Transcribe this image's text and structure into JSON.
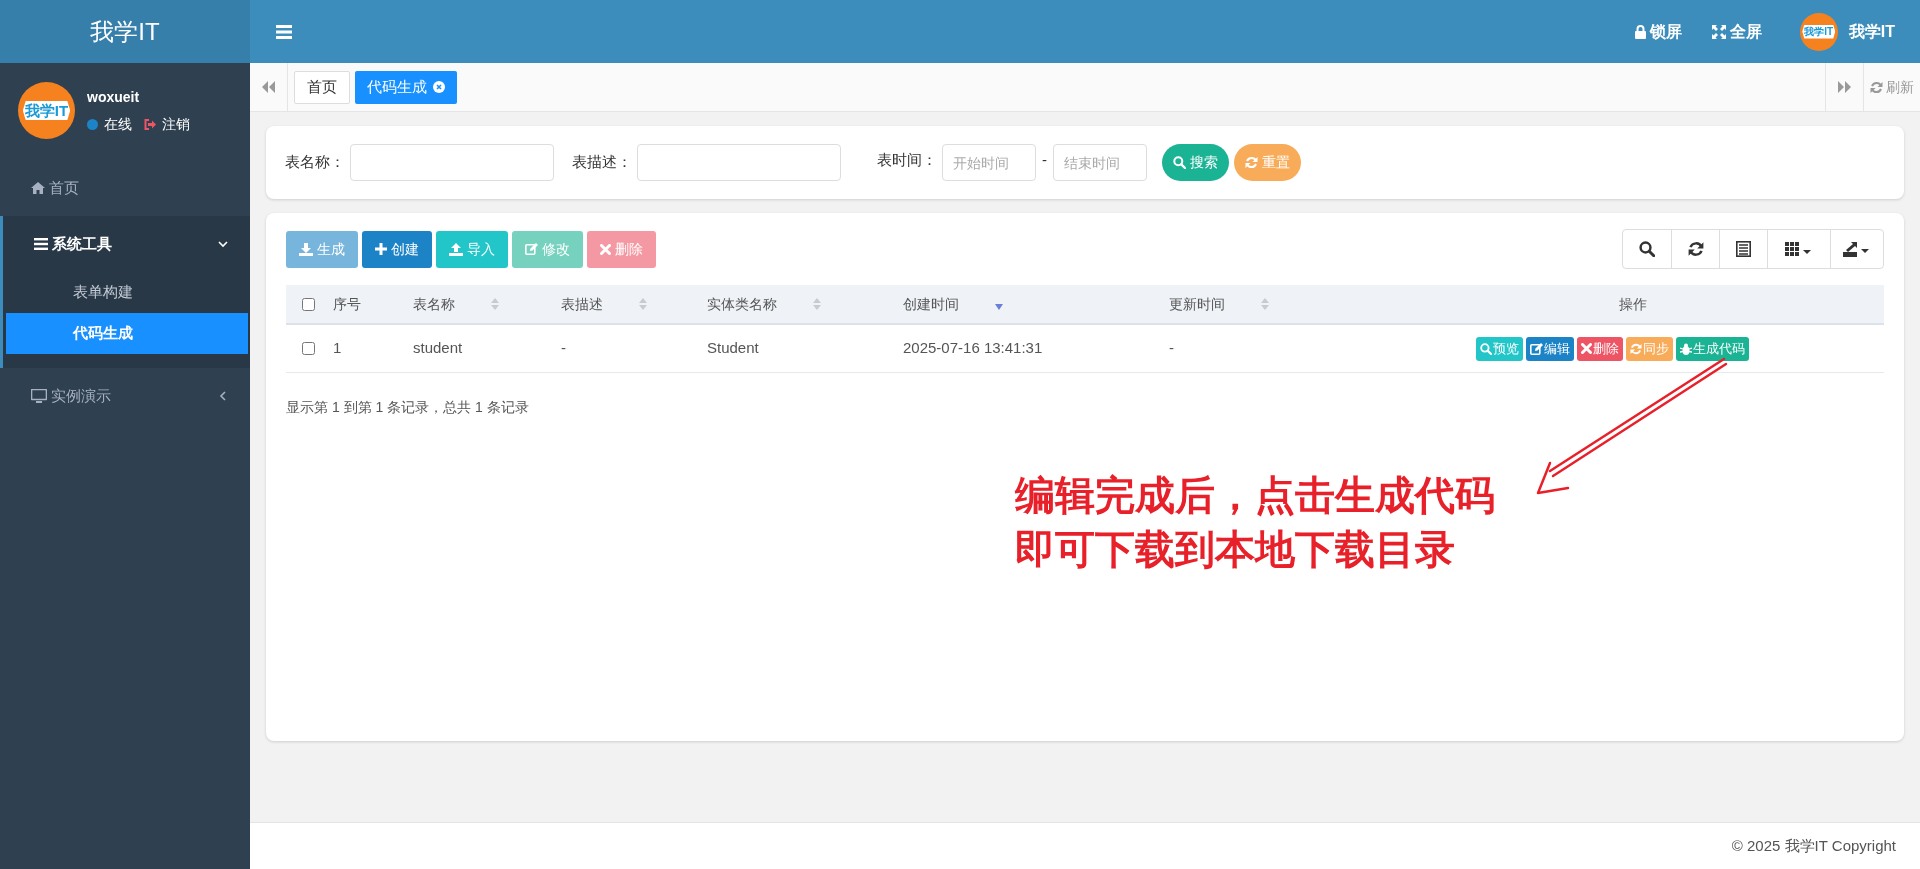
{
  "brand": "我学IT",
  "header": {
    "actions": [
      {
        "kind": "lock",
        "label": "锁屏"
      },
      {
        "kind": "fullscreen",
        "label": "全屏"
      }
    ],
    "user": {
      "logo_text": "我学IT",
      "name": "我学IT"
    }
  },
  "sidebar": {
    "user": {
      "logo_text": "我学IT",
      "name": "woxueit",
      "status": "在线",
      "logout": "注销"
    },
    "items": [
      {
        "kind": "home",
        "label": "首页"
      },
      {
        "kind": "tools",
        "label": "系统工具",
        "expanded": true,
        "children": [
          {
            "label": "表单构建",
            "selected": false
          },
          {
            "label": "代码生成",
            "selected": true
          }
        ]
      },
      {
        "kind": "demo",
        "label": "实例演示",
        "expanded": false
      }
    ]
  },
  "tabs": [
    {
      "label": "首页",
      "selected": false,
      "closable": false
    },
    {
      "label": "代码生成",
      "selected": true,
      "closable": true
    }
  ],
  "refresh": "刷新",
  "search": {
    "fields": [
      {
        "label": "表名称："
      },
      {
        "label": "表描述："
      }
    ],
    "time": {
      "label": "表时间：",
      "start_placeholder": "开始时间",
      "separator": "-",
      "end_placeholder": "结束时间"
    },
    "buttons": [
      {
        "kind": "search",
        "label": "搜索"
      },
      {
        "kind": "reset",
        "label": "重置"
      }
    ]
  },
  "toolbar": [
    {
      "kind": "generate",
      "label": "生成",
      "disabled": true
    },
    {
      "kind": "create",
      "label": "创建",
      "disabled": false
    },
    {
      "kind": "import",
      "label": "导入",
      "disabled": false
    },
    {
      "kind": "edit",
      "label": "修改",
      "disabled": true
    },
    {
      "kind": "delete",
      "label": "删除",
      "disabled": true
    }
  ],
  "table": {
    "columns": [
      {
        "label": "序号",
        "kind": "plain"
      },
      {
        "label": "表名称",
        "kind": "sortable"
      },
      {
        "label": "表描述",
        "kind": "sortable"
      },
      {
        "label": "实体类名称",
        "kind": "sortable"
      },
      {
        "label": "创建时间",
        "kind": "sorted_desc"
      },
      {
        "label": "更新时间",
        "kind": "sortable"
      },
      {
        "label": "操作",
        "kind": "plain"
      }
    ],
    "header_checked": false,
    "rows": [
      {
        "checked": false,
        "cells": [
          "1",
          "student",
          "-",
          "Student",
          "2025-07-16 13:41:31",
          "-"
        ],
        "actions": [
          {
            "kind": "preview",
            "label": "预览"
          },
          {
            "kind": "edit",
            "label": "编辑"
          },
          {
            "kind": "delete",
            "label": "删除"
          },
          {
            "kind": "sync",
            "label": "同步"
          },
          {
            "kind": "generate",
            "label": "生成代码"
          }
        ]
      }
    ]
  },
  "pagination": "显示第 1 到第 1 条记录，总共 1 条记录",
  "annotation": {
    "lines": [
      "编辑完成后，点击生成代码",
      "即可下载到本地下载目录"
    ]
  },
  "footer": "© 2025 我学IT Copyright"
}
